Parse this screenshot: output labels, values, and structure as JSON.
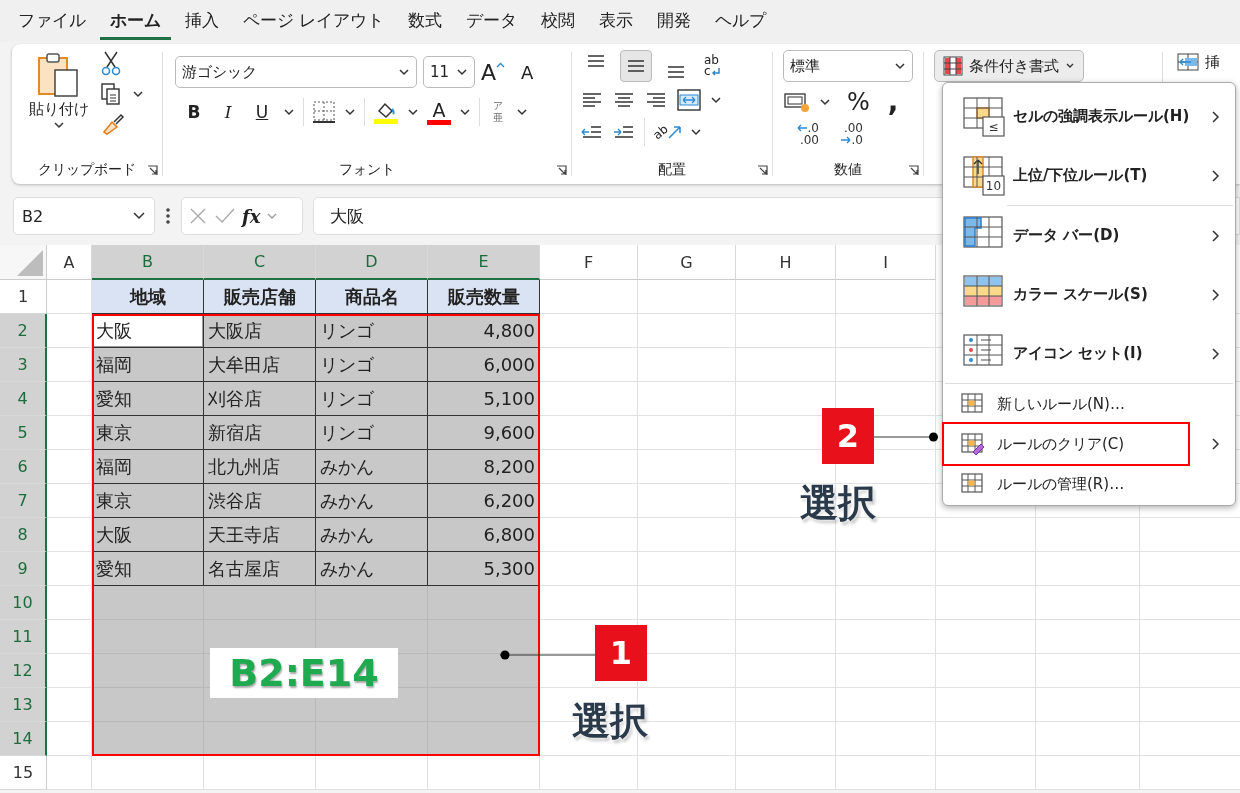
{
  "ribbon_tabs": [
    {
      "label": "ファイル",
      "selected": false
    },
    {
      "label": "ホーム",
      "selected": true
    },
    {
      "label": "挿入",
      "selected": false
    },
    {
      "label": "ページ レイアウト",
      "selected": false
    },
    {
      "label": "数式",
      "selected": false
    },
    {
      "label": "データ",
      "selected": false
    },
    {
      "label": "校閲",
      "selected": false
    },
    {
      "label": "表示",
      "selected": false
    },
    {
      "label": "開発",
      "selected": false
    },
    {
      "label": "ヘルプ",
      "selected": false
    }
  ],
  "clipboard": {
    "paste_label": "貼り付け",
    "group_label": "クリップボード"
  },
  "font": {
    "name": "游ゴシック",
    "size": "11",
    "grow": "A",
    "shrink": "A",
    "bold": "B",
    "italic": "I",
    "underline": "U",
    "font_color": "A",
    "phonetic": [
      "ア",
      "亜"
    ],
    "group_label": "フォント"
  },
  "alignment": {
    "vertical": [
      {
        "selected": false
      },
      {
        "selected": true
      },
      {
        "selected": false
      }
    ],
    "wrap_icon": [
      "ab",
      "c"
    ],
    "orientation_icon": "ab",
    "group_label": "配置"
  },
  "number": {
    "format": "標準",
    "percent": "%",
    "comma": ",",
    "increase_decimal": [
      ".0",
      ".00"
    ],
    "decrease_decimal": [
      ".00",
      ".0"
    ],
    "group_label": "数値"
  },
  "styles": {
    "conditional_format": "条件付き書式",
    "open": true
  },
  "cells_group": {
    "insert": "挿"
  },
  "formula_bar": {
    "name_box": "B2",
    "fx": "fx",
    "value": "大阪"
  },
  "sheet": {
    "columns": [
      {
        "label": "A",
        "selected": false
      },
      {
        "label": "B",
        "selected": true
      },
      {
        "label": "C",
        "selected": true
      },
      {
        "label": "D",
        "selected": true
      },
      {
        "label": "E",
        "selected": true
      },
      {
        "label": "F",
        "selected": false
      },
      {
        "label": "G",
        "selected": false
      },
      {
        "label": "H",
        "selected": false
      },
      {
        "label": "I",
        "selected": false
      }
    ],
    "rows": [
      {
        "number": "1",
        "kind": "header",
        "selected": false,
        "cells": [
          {
            "text": "地域"
          },
          {
            "text": "販売店舗"
          },
          {
            "text": "商品名"
          },
          {
            "text": "販売数量"
          }
        ]
      },
      {
        "number": "2",
        "kind": "data",
        "selected": true,
        "cells": [
          {
            "text": "大阪",
            "active": true
          },
          {
            "text": "大阪店",
            "active": false
          },
          {
            "text": "リンゴ",
            "active": false
          },
          {
            "text": "4,800",
            "active": false
          }
        ]
      },
      {
        "number": "3",
        "kind": "data",
        "selected": true,
        "cells": [
          {
            "text": "福岡",
            "active": false
          },
          {
            "text": "大牟田店",
            "active": false
          },
          {
            "text": "リンゴ",
            "active": false
          },
          {
            "text": "6,000",
            "active": false
          }
        ]
      },
      {
        "number": "4",
        "kind": "data",
        "selected": true,
        "cells": [
          {
            "text": "愛知",
            "active": false
          },
          {
            "text": "刈谷店",
            "active": false
          },
          {
            "text": "リンゴ",
            "active": false
          },
          {
            "text": "5,100",
            "active": false
          }
        ]
      },
      {
        "number": "5",
        "kind": "data",
        "selected": true,
        "cells": [
          {
            "text": "東京",
            "active": false
          },
          {
            "text": "新宿店",
            "active": false
          },
          {
            "text": "リンゴ",
            "active": false
          },
          {
            "text": "9,600",
            "active": false
          }
        ]
      },
      {
        "number": "6",
        "kind": "data",
        "selected": true,
        "cells": [
          {
            "text": "福岡",
            "active": false
          },
          {
            "text": "北九州店",
            "active": false
          },
          {
            "text": "みかん",
            "active": false
          },
          {
            "text": "8,200",
            "active": false
          }
        ]
      },
      {
        "number": "7",
        "kind": "data",
        "selected": true,
        "cells": [
          {
            "text": "東京",
            "active": false
          },
          {
            "text": "渋谷店",
            "active": false
          },
          {
            "text": "みかん",
            "active": false
          },
          {
            "text": "6,200",
            "active": false
          }
        ]
      },
      {
        "number": "8",
        "kind": "data",
        "selected": true,
        "cells": [
          {
            "text": "大阪",
            "active": false
          },
          {
            "text": "天王寺店",
            "active": false
          },
          {
            "text": "みかん",
            "active": false
          },
          {
            "text": "6,800",
            "active": false
          }
        ]
      },
      {
        "number": "9",
        "kind": "data",
        "selected": true,
        "cells": [
          {
            "text": "愛知",
            "active": false
          },
          {
            "text": "名古屋店",
            "active": false
          },
          {
            "text": "みかん",
            "active": false
          },
          {
            "text": "5,300",
            "active": false
          }
        ]
      },
      {
        "number": "10",
        "kind": "empty",
        "selected": true
      },
      {
        "number": "11",
        "kind": "empty",
        "selected": true
      },
      {
        "number": "12",
        "kind": "empty",
        "selected": true
      },
      {
        "number": "13",
        "kind": "empty",
        "selected": true
      },
      {
        "number": "14",
        "kind": "empty",
        "selected": true
      },
      {
        "number": "15",
        "kind": "empty",
        "selected": false
      }
    ]
  },
  "conditional_menu": [
    {
      "kind": "large",
      "label": "セルの強調表示ルール(H)",
      "icon_text": "≤",
      "submenu": true
    },
    {
      "kind": "large",
      "label": "上位/下位ルール(T)",
      "icon_text": "10",
      "submenu": true
    },
    {
      "kind": "large",
      "label": "データ バー(D)",
      "submenu": true
    },
    {
      "kind": "large",
      "label": "カラー スケール(S)",
      "submenu": true
    },
    {
      "kind": "large",
      "label": "アイコン セット(I)",
      "submenu": true
    },
    {
      "kind": "small",
      "label": "新しいルール(N)…",
      "submenu": false
    },
    {
      "kind": "small",
      "label": "ルールのクリア(C)",
      "submenu": true
    },
    {
      "kind": "small",
      "label": "ルールの管理(R)…",
      "submenu": false
    }
  ],
  "annotations": {
    "range_label": "B2:E14",
    "callouts": [
      {
        "number": "1",
        "caption": "選択"
      },
      {
        "number": "2",
        "caption": "選択"
      }
    ]
  }
}
